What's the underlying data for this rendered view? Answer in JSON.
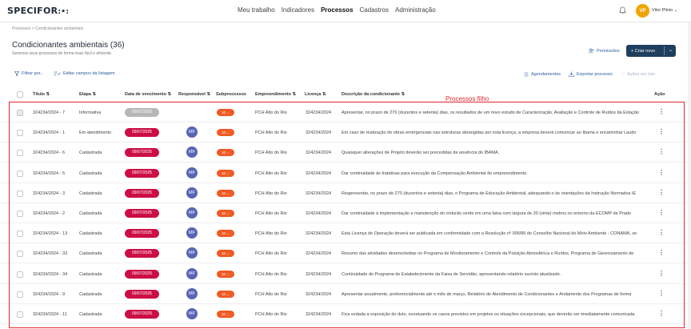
{
  "app": {
    "logo": "SPECIFOR",
    "logo_mark": ":•:"
  },
  "nav": [
    "Meu trabalho",
    "Indicadores",
    "Processos",
    "Cadastros",
    "Administração"
  ],
  "nav_active": "Processos",
  "user": {
    "initials": "VP",
    "name": "Vitor Plinio ⌄"
  },
  "breadcrumb": "Processos  >  Condicionantes ambientais",
  "page": {
    "title": "Condicionantes ambientais (36)",
    "subtitle": "Gerencie seus processos de forma mais fácil e eficiente.",
    "permissions_label": "Permissões",
    "new_label": "+  Criar novo",
    "new_caret": "⌄"
  },
  "toolbar": {
    "filter_label": "Filtrar por...",
    "edit_fields_label": "Editar campos da listagem",
    "schedules_label": "Agendamentos",
    "export_label": "Exportar processo",
    "batch_label": "Ações em lote"
  },
  "columns": {
    "titulo": "Título ⇅",
    "etapa": "Etapa ⇅",
    "vencimento": "Data de vencimento ⇅",
    "responsavel": "Responsável ⇅",
    "subprocessos": "Subprocessos",
    "empreendimento": "Empreendimento ⇅",
    "licenca": "Licença ⇅",
    "descricao": "Descrição da condicionante ⇅",
    "acao": "Ação"
  },
  "annotation": "Processos filho",
  "rows": [
    {
      "titulo": "324234/2024 - 7",
      "etapa": "Informativa",
      "vencimento": "09/07/2025",
      "responsavel": "",
      "sub": "10 ⌄",
      "emp": "PCH Alto do Rio",
      "lic": "324234/2024",
      "desc": "Apresentar, no prazo de 270 (duzentos e setenta) dias, os resultados de um novo estudo de Caracterização, Avaliação e Controle de Ruídos da Estação"
    },
    {
      "titulo": "324234/2024 - 1",
      "etapa": "Em atendimento",
      "vencimento": "09/07/2025",
      "responsavel": "MF",
      "sub": "10 ⌄",
      "emp": "PCH Alto do Rio",
      "lic": "324234/2024",
      "desc": "Em caso de realização de obras emergenciais nas estruturas abrangidas por esta licença, a empresa deverá comunicar ao Ibama e encaminhar Laudo"
    },
    {
      "titulo": "324234/2024 - 6",
      "etapa": "Cadastrada",
      "vencimento": "09/07/2025",
      "responsavel": "MF",
      "sub": "10 ⌄",
      "emp": "PCH Alto do Rio",
      "lic": "324234/2024",
      "desc": "Quaisquer alterações de Projeto deverão ser precedidas de anuência do IBAMA."
    },
    {
      "titulo": "324234/2024 - 5",
      "etapa": "Cadastrada",
      "vencimento": "09/07/2025",
      "responsavel": "MF",
      "sub": "10 ⌄",
      "emp": "PCH Alto do Rio",
      "lic": "324234/2024",
      "desc": "Dar continuidade às tratativas para execução da Compensação Ambiental do empreendimento."
    },
    {
      "titulo": "324234/2024 - 3",
      "etapa": "Cadastrada",
      "vencimento": "09/07/2025",
      "responsavel": "MF",
      "sub": "10 ⌄",
      "emp": "PCH Alto do Rio",
      "lic": "324234/2024",
      "desc": "Reapresentar, no prazo de 270 (duzentos e setenta) dias, o Programa de Educação Ambiental, adequando-o às orientações da Instrução Normativa IE"
    },
    {
      "titulo": "324234/2024 - 2",
      "etapa": "Cadastrada",
      "vencimento": "09/07/2025",
      "responsavel": "MF",
      "sub": "10 ⌄",
      "emp": "PCH Alto do Rio",
      "lic": "324234/2024",
      "desc": "Dar continuidade à implementação e manutenção do cinturão verde em uma faixa com largura de 20 (vinte) metros no entorno da ECOMP de Prado"
    },
    {
      "titulo": "324234/2024 - 13",
      "etapa": "Cadastrada",
      "vencimento": "09/07/2025",
      "responsavel": "MF",
      "sub": "10 ⌄",
      "emp": "PCH Alto do Rio",
      "lic": "324234/2024",
      "desc": "Esta Licença de Operação deverá ser publicada em conformidade com a Resolução nº 006/86 do Conselho Nacional do Meio Ambiente - CONAMA, se"
    },
    {
      "titulo": "324234/2024 - 33",
      "etapa": "Cadastrada",
      "vencimento": "09/07/2025",
      "responsavel": "MF",
      "sub": "10 ⌄",
      "emp": "PCH Alto do Rio",
      "lic": "324234/2024",
      "desc": "Resumo das atividades desenvolvidas no Programa de Monitoramento e Controle da Poluição Atmosférica e Ruídos, Programa de Gerenciamento de"
    },
    {
      "titulo": "324234/2024 - 34",
      "etapa": "Cadastrada",
      "vencimento": "09/07/2025",
      "responsavel": "MF",
      "sub": "10 ⌄",
      "emp": "PCH Alto do Rio",
      "lic": "324234/2024",
      "desc": "Continuidade do Programa de Estabelecimento da Faixa de Servidão, apresentando relatório sucinto atualizado."
    },
    {
      "titulo": "324234/2024 - 9",
      "etapa": "Cadastrada",
      "vencimento": "09/07/2025",
      "responsavel": "MF",
      "sub": "10 ⌄",
      "emp": "PCH Alto do Rio",
      "lic": "324234/2024",
      "desc": "Apresentar anualmente, preferencialmente até o mês de março, Relatório de Atendimento de Condicionantes e Andamento dos Programas de forma"
    },
    {
      "titulo": "324234/2024 - 11",
      "etapa": "Cadastrada",
      "vencimento": "09/07/2025",
      "responsavel": "MF",
      "sub": "10 ⌄",
      "emp": "PCH Alto do Rio",
      "lic": "324234/2024",
      "desc": "Fica vedada a exposição do duto, excetuando os casos previstos em projetos ou situações excepcionais, que deverão ser imediatamente comunicada"
    }
  ],
  "colors": {
    "date_red": "#cc0e45",
    "date_grey": "#b7b7b7",
    "badge_orange": "#f05a24",
    "avatar_blue": "#5865b7",
    "primary": "#1f3f5e",
    "annotation_red": "#e0262f"
  }
}
